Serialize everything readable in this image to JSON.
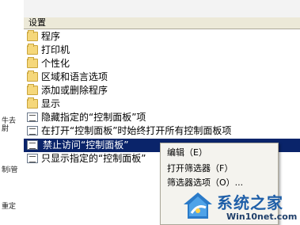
{
  "side_labels": [
    "牛去尉",
    "制i管",
    "重定"
  ],
  "header": {
    "title": "设置"
  },
  "folders": [
    {
      "label": "程序"
    },
    {
      "label": "打印机"
    },
    {
      "label": "个性化"
    },
    {
      "label": "区域和语言选项"
    },
    {
      "label": "添加或删除程序"
    },
    {
      "label": "显示"
    }
  ],
  "policies": [
    {
      "label": "隐藏指定的“控制面板”项"
    },
    {
      "label": "在打开“控制面板”时始终打开所有控制面板项"
    },
    {
      "label": "禁止访问“控制面板”"
    },
    {
      "label": "只显示指定的“控制面板”"
    }
  ],
  "context_menu": {
    "items": [
      {
        "label": "编辑（E）"
      },
      {
        "label": "打开筛选器（F）"
      },
      {
        "label": "筛选器选项（O）..."
      }
    ]
  },
  "watermark": {
    "title": "系统之家",
    "url": "Win10net.com"
  },
  "colors": {
    "selection": "#0a246a",
    "header_bg": "#ece9d8",
    "folder": "#f5d77a",
    "watermark_blue": "#1f5fa8"
  }
}
